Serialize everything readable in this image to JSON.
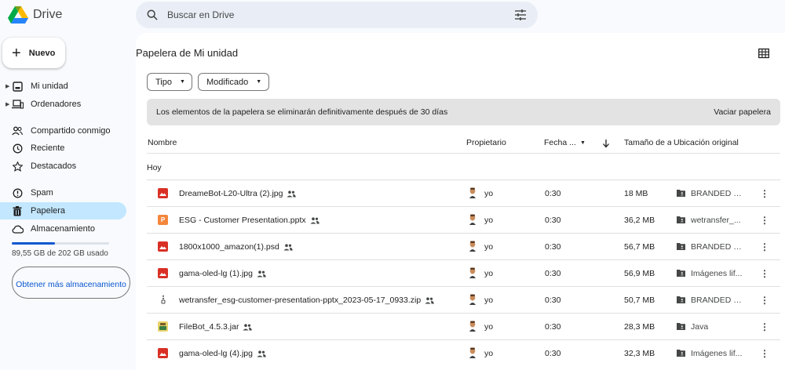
{
  "app": {
    "name": "Drive"
  },
  "search": {
    "placeholder": "Buscar en Drive"
  },
  "sidebar": {
    "new_label": "Nuevo",
    "items": [
      {
        "label": "Mi unidad",
        "icon": "drive-icon"
      },
      {
        "label": "Ordenadores",
        "icon": "computer-icon"
      },
      {
        "label": "Compartido conmigo",
        "icon": "people-icon"
      },
      {
        "label": "Reciente",
        "icon": "clock-icon"
      },
      {
        "label": "Destacados",
        "icon": "star-icon"
      },
      {
        "label": "Spam",
        "icon": "alert-icon"
      },
      {
        "label": "Papelera",
        "icon": "trash-icon"
      },
      {
        "label": "Almacenamiento",
        "icon": "cloud-icon"
      }
    ],
    "storage": {
      "used_text": "89,55 GB de 202 GB usado",
      "used_fraction": 0.443
    },
    "more_storage_label": "Obtener más almacenamiento"
  },
  "main": {
    "title": "Papelera de Mi unidad",
    "filters": [
      {
        "label": "Tipo"
      },
      {
        "label": "Modificado"
      }
    ],
    "banner": {
      "text": "Los elementos de la papelera se eliminarán definitivamente después de 30 días",
      "action": "Vaciar papelera"
    },
    "columns": {
      "name": "Nombre",
      "owner": "Propietario",
      "date": "Fecha ...",
      "size": "Tamaño de a",
      "location": "Ubicación original"
    },
    "group": "Hoy",
    "rows": [
      {
        "name": "DreameBot-L20-Ultra (2).jpg",
        "type": "image",
        "owner": "yo",
        "date": "0:30",
        "size": "18 MB",
        "location": "BRANDED - ..."
      },
      {
        "name": "ESG - Customer Presentation.pptx",
        "type": "slides",
        "owner": "yo",
        "date": "0:30",
        "size": "36,2 MB",
        "location": "wetransfer_..."
      },
      {
        "name": "1800x1000_amazon(1).psd",
        "type": "image",
        "owner": "yo",
        "date": "0:30",
        "size": "56,7 MB",
        "location": "BRANDED - ..."
      },
      {
        "name": "gama-oled-lg (1).jpg",
        "type": "image",
        "owner": "yo",
        "date": "0:30",
        "size": "56,9 MB",
        "location": "Imágenes lif..."
      },
      {
        "name": "wetransfer_esg-customer-presentation-pptx_2023-05-17_0933.zip",
        "type": "zip",
        "owner": "yo",
        "date": "0:30",
        "size": "50,7 MB",
        "location": "BRANDED - ..."
      },
      {
        "name": "FileBot_4.5.3.jar",
        "type": "jar",
        "owner": "yo",
        "date": "0:30",
        "size": "28,3 MB",
        "location": "Java"
      },
      {
        "name": "gama-oled-lg (4).jpg",
        "type": "image",
        "owner": "yo",
        "date": "0:30",
        "size": "32,3 MB",
        "location": "Imágenes lif..."
      }
    ]
  },
  "colors": {
    "accent": "#0b57d0",
    "active_nav": "#c2e7ff",
    "image_icon": "#d93025",
    "slides_icon": "#f4863c"
  }
}
